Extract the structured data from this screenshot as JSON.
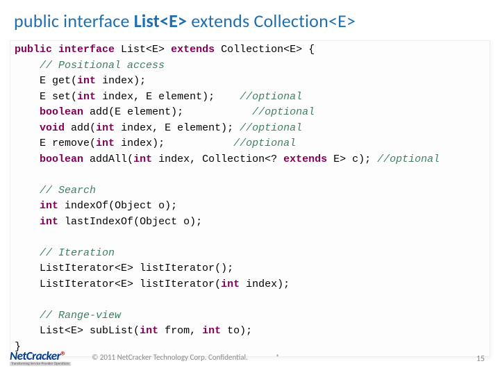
{
  "title": {
    "prefix": "public interface ",
    "bold": "List<E>",
    "suffix": " extends Collection<E>"
  },
  "code": {
    "l1_kw1": "public",
    "l1_sp1": " ",
    "l1_kw2": "interface",
    "l1_sp2": " List<E> ",
    "l1_kw3": "extends",
    "l1_rest": " Collection<E> {",
    "l2_pad": "    ",
    "l2": "// Positional access",
    "l3_pad": "    E ",
    "l3_m": "get",
    "l3_a1": "(",
    "l3_kw": "int",
    "l3_rest": " index);",
    "l4_pad": "    E ",
    "l4_m": "set",
    "l4_a1": "(",
    "l4_kw": "int",
    "l4_rest": " index, E element);    ",
    "l4_c": "//optional",
    "l5_pad": "    ",
    "l5_kw1": "boolean",
    "l5_sp": " ",
    "l5_m": "add",
    "l5_a1": "(E element);           ",
    "l5_c": "//optional",
    "l6_pad": "    ",
    "l6_kw1": "void",
    "l6_sp": " ",
    "l6_m": "add",
    "l6_a1": "(",
    "l6_kw2": "int",
    "l6_rest": " index, E element); ",
    "l6_c": "//optional",
    "l7_pad": "    E ",
    "l7_m": "remove",
    "l7_a1": "(",
    "l7_kw": "int",
    "l7_rest": " index);           ",
    "l7_c": "//optional",
    "l8_pad": "    ",
    "l8_kw1": "boolean",
    "l8_sp": " ",
    "l8_m": "addAll",
    "l8_a1": "(",
    "l8_kw2": "int",
    "l8_mid": " index, Collection<? ",
    "l8_kw3": "extends",
    "l8_rest": " E> c); ",
    "l8_c": "//optional",
    "blank": " ",
    "l10_pad": "    ",
    "l10": "// Search",
    "l11_pad": "    ",
    "l11_kw": "int",
    "l11_sp": " ",
    "l11_m": "indexOf",
    "l11_rest": "(Object o);",
    "l12_pad": "    ",
    "l12_kw": "int",
    "l12_sp": " ",
    "l12_m": "lastIndexOf",
    "l12_rest": "(Object o);",
    "l14_pad": "    ",
    "l14": "// Iteration",
    "l15_pad": "    ListIterator<E> ",
    "l15_m": "listIterator",
    "l15_rest": "();",
    "l16_pad": "    ListIterator<E> ",
    "l16_m": "listIterator",
    "l16_a1": "(",
    "l16_kw": "int",
    "l16_rest": " index);",
    "l18_pad": "    ",
    "l18": "// Range-view",
    "l19_pad": "    List<E> ",
    "l19_m": "subList",
    "l19_a1": "(",
    "l19_kw1": "int",
    "l19_mid": " from, ",
    "l19_kw2": "int",
    "l19_rest": " to);",
    "l20": "}"
  },
  "footer": {
    "logo_main": "NetCracker",
    "logo_reg": "®",
    "logo_sub": "Transforming Service Provider Operations",
    "copyright": "© 2011 NetCracker Technology Corp. Confidential.",
    "star": "*",
    "page": "15"
  }
}
